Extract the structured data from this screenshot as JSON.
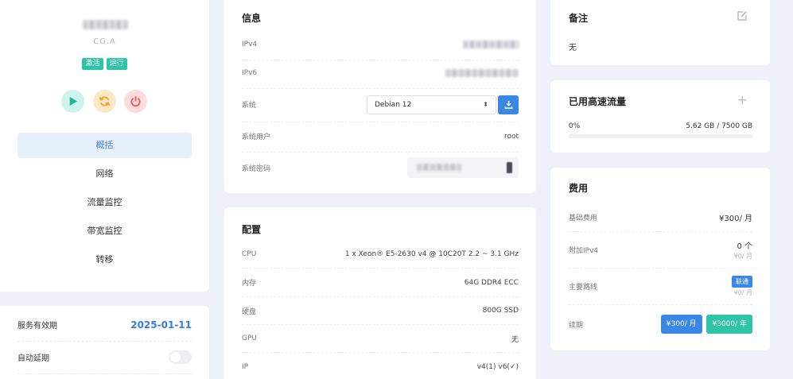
{
  "server": {
    "location": "CG.A",
    "badges": [
      "激活",
      "运行"
    ],
    "controls": [
      "play-icon",
      "refresh-icon",
      "power-icon"
    ],
    "nav": [
      "概括",
      "网络",
      "流量监控",
      "带宽监控",
      "转移"
    ]
  },
  "service": {
    "expiry_label": "服务有效期",
    "expiry_value": "2025-01-11",
    "autorenew_label": "自动延期"
  },
  "info": {
    "title": "信息",
    "ipv4_label": "IPv4",
    "ipv6_label": "IPv6",
    "os_label": "系统",
    "os_value": "Debian 12",
    "user_label": "系统用户",
    "user_value": "root",
    "password_label": "系统密码"
  },
  "config": {
    "title": "配置",
    "rows": [
      {
        "label": "CPU",
        "value": "1 x Xeon® E5-2630 v4 @ 10C20T 2.2 ~ 3.1 GHz"
      },
      {
        "label": "内存",
        "value": "64G DDR4 ECC"
      },
      {
        "label": "硬盘",
        "value": "800G SSD"
      },
      {
        "label": "GPU",
        "value": "无"
      },
      {
        "label": "IP",
        "value": "v4(1) v6(✓)"
      }
    ]
  },
  "note": {
    "title": "备注",
    "text": "无"
  },
  "traffic": {
    "title": "已用高速流量",
    "percent_label": "0%",
    "percent": 0,
    "usage": "5.62 GB / 7500 GB"
  },
  "cost": {
    "title": "费用",
    "base_label": "基础费用",
    "base_value": "¥300/ 月",
    "ipv4_label": "附加IPv4",
    "ipv4_value": "0 个",
    "ipv4_sub": "¥0/ 月",
    "route_label": "主要路线",
    "route_tag": "联通",
    "route_sub": "¥0/ 月",
    "renew_label": "续期",
    "renew_month": "¥300/ 月",
    "renew_year": "¥3000/ 年"
  },
  "colors": {
    "accent": "#3b87e6",
    "teal": "#2ec4a8",
    "bg": "#eef1f7"
  }
}
